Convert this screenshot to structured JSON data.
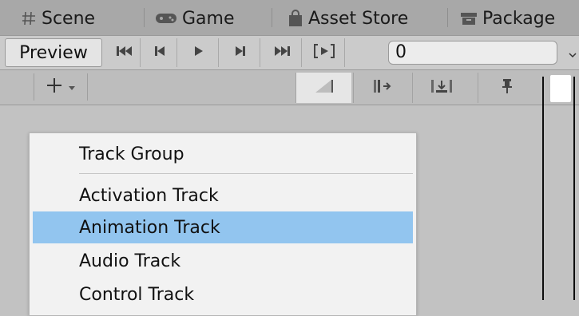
{
  "tabs": [
    {
      "label": "Scene",
      "icon": "hash-icon"
    },
    {
      "label": "Game",
      "icon": "gamepad-icon"
    },
    {
      "label": "Asset Store",
      "icon": "shopping-bag-icon"
    },
    {
      "label": "Package",
      "icon": "package-icon"
    }
  ],
  "toolbar": {
    "preview_label": "Preview",
    "frame_value": "0",
    "buttons": [
      "jump-to-start-icon",
      "previous-frame-icon",
      "play-icon",
      "next-frame-icon",
      "jump-to-end-icon",
      "play-range-icon"
    ]
  },
  "subtoolbar": {
    "add_label": "+",
    "buttons": [
      "edit-mode-icon",
      "ripple-mode-icon",
      "replace-mode-icon",
      "pin-icon"
    ]
  },
  "menu": {
    "items": [
      {
        "label": "Track Group",
        "highlighted": false
      },
      {
        "label": "Activation Track",
        "highlighted": false
      },
      {
        "label": "Animation Track",
        "highlighted": true
      },
      {
        "label": "Audio Track",
        "highlighted": false
      },
      {
        "label": "Control Track",
        "highlighted": false
      }
    ]
  },
  "colors": {
    "highlight": "#92c5ef",
    "background": "#c2c2c2",
    "tabbar": "#a8a8a8"
  }
}
